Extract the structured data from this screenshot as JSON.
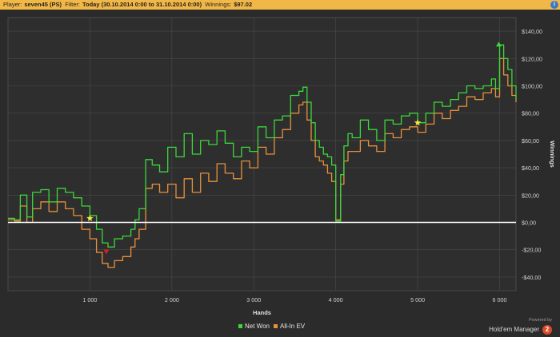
{
  "header": {
    "player_label": "Player:",
    "player_value": "seven45 (PS)",
    "filter_label": "Filter:",
    "filter_value": "Today (30.10.2014 0:00 to 31.10.2014 0:00)",
    "winnings_label": "Winnings:",
    "winnings_value": "$97.02",
    "info_icon": "info-icon"
  },
  "footer": {
    "powered_by": "Powered by",
    "brand_name": "Hold'em Manager",
    "brand_logo_text": "2"
  },
  "colors": {
    "background": "#2b2b2b",
    "header_bar": "#f2b847",
    "grid": "#4a4a4a",
    "zero_line": "#ffffff",
    "net_won": "#3ad83a",
    "allin_ev": "#e8903a",
    "star": "#f4e842",
    "max_marker": "#3ad83a",
    "min_marker": "#d9202a"
  },
  "chart_data": {
    "type": "line",
    "xlabel": "Hands",
    "ylabel": "Winnings",
    "xlim": [
      0,
      6200
    ],
    "ylim": [
      -50,
      150
    ],
    "x_ticks": [
      1000,
      2000,
      3000,
      4000,
      5000,
      6000
    ],
    "x_tick_labels": [
      "1 000",
      "2 000",
      "3 000",
      "4 000",
      "5 000",
      "6 000"
    ],
    "y_ticks": [
      -40,
      -20,
      0,
      20,
      40,
      60,
      80,
      100,
      120,
      140
    ],
    "y_tick_labels": [
      "-$40,00",
      "-$20,00",
      "$0,00",
      "$20,00",
      "$40,00",
      "$60,00",
      "$80,00",
      "$100,00",
      "$120,00",
      "$140,00"
    ],
    "legend_position": "bottom-center",
    "grid": true,
    "series": [
      {
        "name": "Net Won",
        "color": "#3ad83a",
        "x": [
          0,
          80,
          150,
          230,
          300,
          400,
          500,
          600,
          700,
          800,
          900,
          1000,
          1080,
          1150,
          1220,
          1300,
          1400,
          1500,
          1550,
          1600,
          1680,
          1760,
          1850,
          1950,
          2050,
          2150,
          2250,
          2350,
          2450,
          2550,
          2650,
          2750,
          2850,
          2950,
          3050,
          3150,
          3250,
          3350,
          3450,
          3550,
          3600,
          3650,
          3700,
          3750,
          3800,
          3850,
          3900,
          3950,
          4000,
          4030,
          4060,
          4100,
          4150,
          4200,
          4300,
          4400,
          4500,
          4600,
          4700,
          4800,
          4900,
          5000,
          5100,
          5200,
          5300,
          5400,
          5500,
          5600,
          5700,
          5800,
          5900,
          5950,
          6000,
          6050,
          6100,
          6150,
          6200
        ],
        "y": [
          3,
          2,
          20,
          4,
          22,
          24,
          15,
          25,
          22,
          18,
          12,
          5,
          -5,
          -15,
          -18,
          -12,
          -10,
          -5,
          2,
          10,
          46,
          42,
          37,
          55,
          48,
          65,
          50,
          60,
          57,
          67,
          58,
          48,
          55,
          52,
          70,
          62,
          75,
          78,
          93,
          96,
          99,
          88,
          73,
          60,
          55,
          50,
          48,
          42,
          1,
          1,
          35,
          56,
          65,
          62,
          75,
          68,
          60,
          75,
          72,
          78,
          80,
          73,
          80,
          88,
          85,
          90,
          95,
          100,
          98,
          100,
          105,
          98,
          130,
          120,
          112,
          100,
          90
        ]
      },
      {
        "name": "All-In EV",
        "color": "#e8903a",
        "x": [
          0,
          80,
          150,
          230,
          300,
          400,
          500,
          600,
          700,
          800,
          900,
          1000,
          1080,
          1150,
          1220,
          1300,
          1400,
          1500,
          1550,
          1600,
          1680,
          1760,
          1850,
          1950,
          2050,
          2150,
          2250,
          2350,
          2450,
          2550,
          2650,
          2750,
          2850,
          2950,
          3050,
          3150,
          3250,
          3350,
          3450,
          3550,
          3600,
          3650,
          3700,
          3750,
          3800,
          3850,
          3900,
          3950,
          4000,
          4030,
          4060,
          4100,
          4150,
          4200,
          4300,
          4400,
          4500,
          4600,
          4700,
          4800,
          4900,
          5000,
          5100,
          5200,
          5300,
          5400,
          5500,
          5600,
          5700,
          5800,
          5900,
          5950,
          6000,
          6050,
          6100,
          6150,
          6200
        ],
        "y": [
          2,
          1,
          12,
          0,
          10,
          15,
          8,
          15,
          10,
          5,
          -5,
          -12,
          -22,
          -30,
          -33,
          -28,
          -25,
          -18,
          -12,
          -5,
          25,
          28,
          22,
          28,
          18,
          32,
          22,
          36,
          30,
          43,
          36,
          32,
          45,
          40,
          55,
          50,
          62,
          68,
          80,
          86,
          88,
          75,
          60,
          48,
          45,
          42,
          36,
          30,
          2,
          2,
          28,
          45,
          52,
          52,
          60,
          56,
          52,
          65,
          62,
          68,
          70,
          66,
          72,
          80,
          76,
          82,
          85,
          92,
          90,
          95,
          98,
          92,
          120,
          108,
          100,
          93,
          88
        ]
      }
    ],
    "markers": [
      {
        "type": "star",
        "x": 1000,
        "y": 3
      },
      {
        "type": "star",
        "x": 5000,
        "y": 73
      },
      {
        "type": "max",
        "x": 5990,
        "y": 130
      },
      {
        "type": "min",
        "x": 1200,
        "y": -21
      }
    ]
  }
}
